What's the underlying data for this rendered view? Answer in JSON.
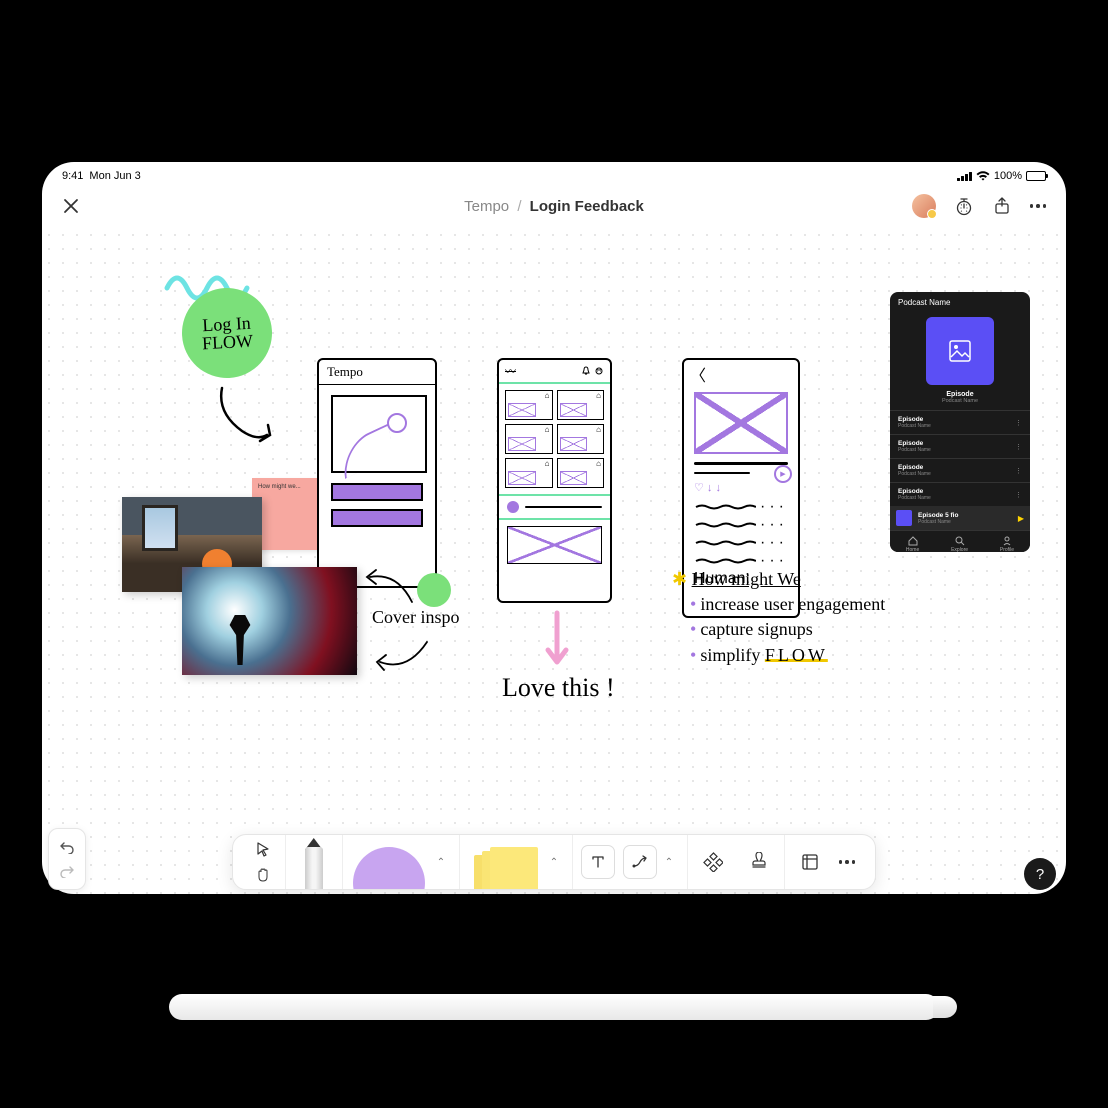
{
  "status": {
    "time": "9:41",
    "date": "Mon Jun 3",
    "battery": "100%"
  },
  "navbar": {
    "breadcrumb_parent": "Tempo",
    "breadcrumb_current": "Login Feedback"
  },
  "canvas": {
    "login_circle_line1": "Log In",
    "login_circle_line2": "FLOW",
    "sticky_pink": "How might we...",
    "wireframe1_title": "Tempo",
    "love_this": "Love this !",
    "cover_inspo": "Cover inspo",
    "hmw_title": "How might We",
    "hmw_items": [
      "increase user engagement",
      "capture signups",
      "simplify"
    ],
    "hmw_flow": "FLOW"
  },
  "podcast": {
    "header": "Podcast Name",
    "title": "Episode",
    "subtitle": "Podcast Name",
    "episodes": [
      {
        "name": "Episode",
        "sub": "Podcast Name"
      },
      {
        "name": "Episode",
        "sub": "Podcast Name"
      },
      {
        "name": "Episode",
        "sub": "Podcast Name"
      },
      {
        "name": "Episode",
        "sub": "Podcast Name"
      }
    ],
    "now_playing": {
      "name": "Episode 5 fio",
      "sub": "Podcast Name"
    },
    "tabs": [
      "Home",
      "Explore",
      "Profile"
    ]
  },
  "help": "?"
}
